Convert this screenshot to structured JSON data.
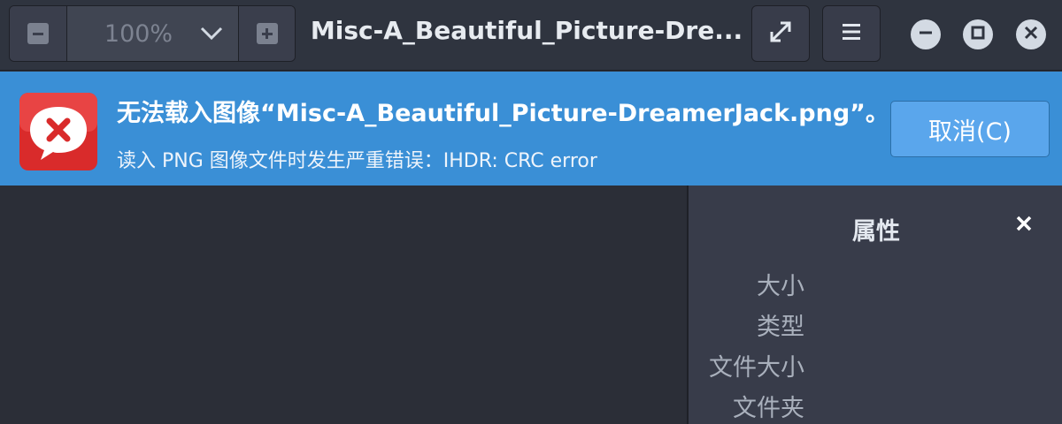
{
  "header": {
    "zoom_value": "100%",
    "title": "Misc-A_Beautiful_Picture-Dre..."
  },
  "infobar": {
    "title": "无法载入图像“Misc-A_Beautiful_Picture-DreamerJack.png”。",
    "detail": "读入 PNG 图像文件时发生严重错误：IHDR: CRC error",
    "cancel_label": "取消(C)"
  },
  "sidebar": {
    "title": "属性",
    "properties": [
      "大小",
      "类型",
      "文件大小",
      "文件夹"
    ]
  },
  "colors": {
    "accent": "#3a8fd6",
    "header_bg": "#2f343f",
    "canvas_bg": "#2b2e37",
    "sidebar_bg": "#383c4a",
    "error_red": "#d92b2b"
  },
  "icons": [
    "zoom-out-icon",
    "chevron-down-icon",
    "zoom-in-icon",
    "fullscreen-icon",
    "hamburger-menu-icon",
    "minimize-icon",
    "maximize-icon",
    "close-icon",
    "error-bubble-icon"
  ]
}
